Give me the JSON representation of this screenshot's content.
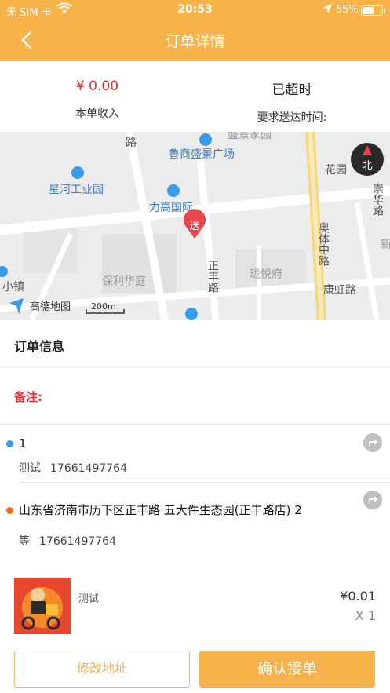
{
  "status_bar": {
    "carrier": "无 SIM 卡",
    "time": "20:53",
    "battery": "55%"
  },
  "nav": {
    "title": "订单详情"
  },
  "summary": {
    "income_value": "¥ 0.00",
    "income_label": "本单收入",
    "status_value": "已超时",
    "status_label": "要求送达时间:"
  },
  "map": {
    "labels": {
      "ludian": "路",
      "shengjing": "盛景家园",
      "lushang": "鲁商盛景广场",
      "xinghe": "星河工业园",
      "ligao": "力高国际",
      "baoli": "保利华庭",
      "longyue": "珑悦府",
      "zhengfeng": "正丰路",
      "aoti": "奥体中路",
      "kanghong": "康虹路",
      "huayuan": "花园",
      "chonghua": "崇华路",
      "xiaozhen": "小镇",
      "xin": "新",
      "send_marker": "送",
      "compass": "北",
      "logo": "高德地图",
      "scale": "200m"
    }
  },
  "order_info": {
    "title": "订单信息"
  },
  "remark": {
    "label": "备注:"
  },
  "pickup": {
    "name": "1",
    "contact": "测试",
    "phone": "17661497764"
  },
  "dropoff": {
    "address": "山东省济南市历下区正丰路 五大件生态园(正丰路店) 2",
    "contact": "等",
    "phone": "17661497764"
  },
  "goods": {
    "name": "测试",
    "price": "¥0.01",
    "qty": "X 1"
  },
  "buttons": {
    "modify": "修改地址",
    "confirm": "确认接单"
  },
  "colors": {
    "accent": "#f7b24a",
    "alert": "#e52d2d",
    "pickup_dot": "#3a9be8",
    "dropoff_dot": "#f06a1a"
  }
}
